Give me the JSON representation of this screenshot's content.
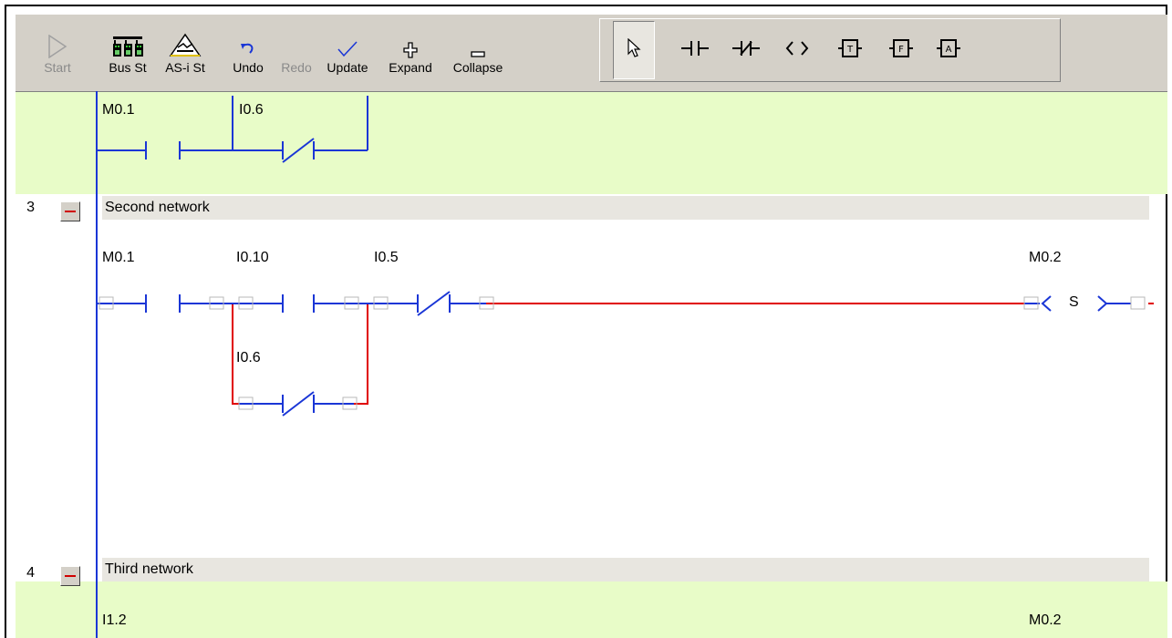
{
  "toolbar": {
    "buttons": [
      {
        "id": "start",
        "label": "Start",
        "icon": "play-icon",
        "enabled": false
      },
      {
        "id": "bus_st",
        "label": "Bus St",
        "icon": "bus-status-icon",
        "enabled": true
      },
      {
        "id": "asi_st",
        "label": "AS-i St",
        "icon": "asi-status-icon",
        "enabled": true
      },
      {
        "id": "undo",
        "label": "Undo",
        "icon": "undo-icon",
        "enabled": true
      },
      {
        "id": "redo",
        "label": "Redo",
        "icon": "redo-icon",
        "enabled": false
      },
      {
        "id": "update",
        "label": "Update",
        "icon": "checkmark-icon",
        "enabled": true
      },
      {
        "id": "expand",
        "label": "Expand",
        "icon": "plus-icon",
        "enabled": true
      },
      {
        "id": "collapse",
        "label": "Collapse",
        "icon": "minus-icon",
        "enabled": true
      }
    ],
    "palette": [
      {
        "id": "select",
        "icon": "pointer-icon",
        "selected": true
      },
      {
        "id": "no_contact",
        "icon": "normally-open-contact-icon"
      },
      {
        "id": "nc_contact",
        "icon": "normally-closed-contact-icon"
      },
      {
        "id": "coil",
        "icon": "coil-icon"
      },
      {
        "id": "timer",
        "icon": "timer-block-icon",
        "glyph": "T"
      },
      {
        "id": "function",
        "icon": "function-block-icon",
        "glyph": "F"
      },
      {
        "id": "analog",
        "icon": "analog-block-icon",
        "glyph": "A"
      }
    ]
  },
  "networks": {
    "net2_partial": {
      "contacts": [
        {
          "address": "M0.1",
          "kind": "NO"
        },
        {
          "address": "I0.6",
          "kind": "NC"
        }
      ]
    },
    "net3": {
      "number": "3",
      "title": "Second network",
      "contacts": [
        {
          "address": "M0.1",
          "kind": "NO"
        },
        {
          "address": "I0.10",
          "kind": "NO"
        },
        {
          "address": "I0.5",
          "kind": "NC"
        },
        {
          "address": "I0.6",
          "kind": "NC"
        }
      ],
      "coil": {
        "address": "M0.2",
        "kind": "S"
      }
    },
    "net4": {
      "number": "4",
      "title": "Third network",
      "contact_address": "I1.2",
      "coil_address": "M0.2"
    }
  },
  "colors": {
    "rail": "#1a36d6",
    "energized": "#e00000",
    "network_bg": "#e8fcc8",
    "header_bg": "#e8e6e0",
    "toolbar_bg": "#d4d0c8"
  }
}
